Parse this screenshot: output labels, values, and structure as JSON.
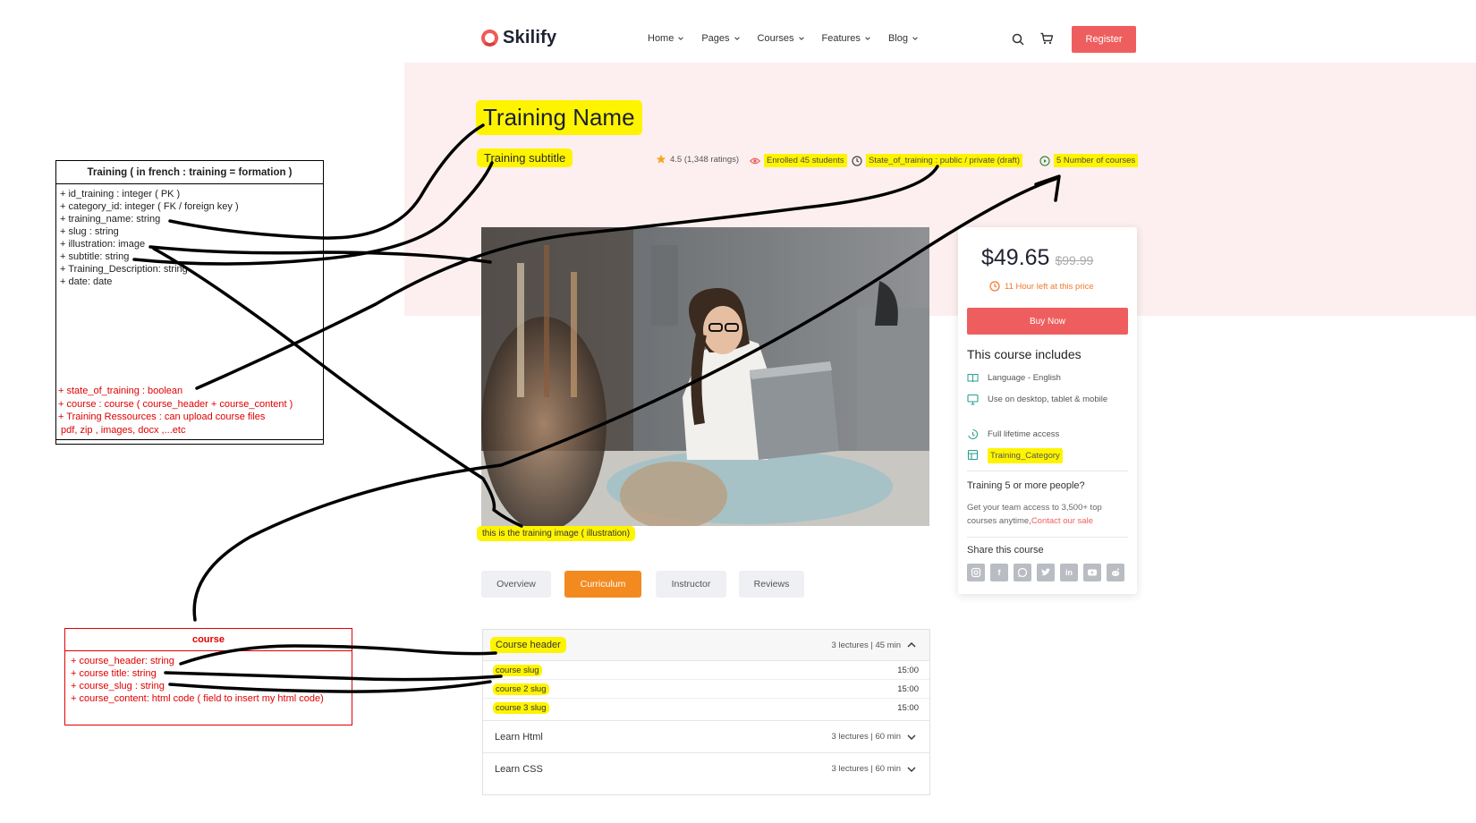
{
  "header": {
    "logo_text": "Skilify",
    "nav": [
      {
        "label": "Home"
      },
      {
        "label": "Pages"
      },
      {
        "label": "Courses"
      },
      {
        "label": "Features"
      },
      {
        "label": "Blog"
      }
    ],
    "register_label": "Register"
  },
  "hero": {
    "title": "Training Name",
    "subtitle": "Training subtitle",
    "rating": "4.5 (1,348 ratings)",
    "enrolled": "Enrolled 45 students",
    "state": "State_of_training : public / private (draft)",
    "courses_count": "5 Number of courses"
  },
  "image_caption": "this is the training image ( illustration)",
  "tabs": [
    {
      "label": "Overview"
    },
    {
      "label": "Curriculum"
    },
    {
      "label": "Instructor"
    },
    {
      "label": "Reviews"
    }
  ],
  "curriculum": {
    "open_section": {
      "title": "Course header",
      "meta": "3 lectures | 45 min",
      "lectures": [
        {
          "name": "course slug",
          "duration": "15:00"
        },
        {
          "name": "course 2 slug",
          "duration": "15:00"
        },
        {
          "name": "course 3 slug",
          "duration": "15:00"
        }
      ]
    },
    "sections": [
      {
        "title": "Learn Html",
        "meta": "3 lectures | 60 min"
      },
      {
        "title": "Learn CSS",
        "meta": "3 lectures | 60 min"
      }
    ]
  },
  "card": {
    "price": "$49.65",
    "old_price": "$99.99",
    "timer": "11 Hour left at this price",
    "buy_label": "Buy Now",
    "includes_title": "This course includes",
    "includes": [
      {
        "text": "Language - English",
        "icon": "book-icon"
      },
      {
        "text": "Use on desktop, tablet & mobile",
        "icon": "monitor-icon"
      },
      {
        "text": "Full lifetime access",
        "icon": "lifetime-icon"
      },
      {
        "text": "Training_Category",
        "icon": "category-icon"
      }
    ],
    "team_title": "Training 5 or more people?",
    "team_desc": "Get your team access to 3,500+ top courses anytime,",
    "team_link": "Contact our sale",
    "share_title": "Share this course",
    "share_icons": [
      "instagram-icon",
      "facebook-icon",
      "whatsapp-icon",
      "twitter-icon",
      "linkedin-icon",
      "youtube-icon",
      "reddit-icon"
    ]
  },
  "uml_training": {
    "title": "Training ( in french : training = formation )",
    "attributes": [
      "+ id_training : integer ( PK )",
      "+ category_id: integer ( FK / foreign key )",
      "+ training_name: string",
      "+ slug : string",
      "+ illustration: image",
      "+ subtitle: string",
      "+ Training_Description: string",
      "+ date: date"
    ],
    "red_attributes": [
      "+ state_of_training : boolean",
      "+ course : course ( course_header + course_content )",
      "+ Training Ressources : can upload course files",
      " pdf, zip , images, docx ,...etc"
    ]
  },
  "uml_course": {
    "title": "course",
    "attributes": [
      "+ course_header: string",
      "+ course title: string",
      "+ course_slug : string",
      "+ course_content: html code ( field to insert my html code)"
    ]
  },
  "colors": {
    "brand": "#ef5e5e",
    "tab_active": "#f28a20",
    "highlight": "#fff400",
    "hero_bg": "#fdefef",
    "uml_red": "#e00000"
  }
}
